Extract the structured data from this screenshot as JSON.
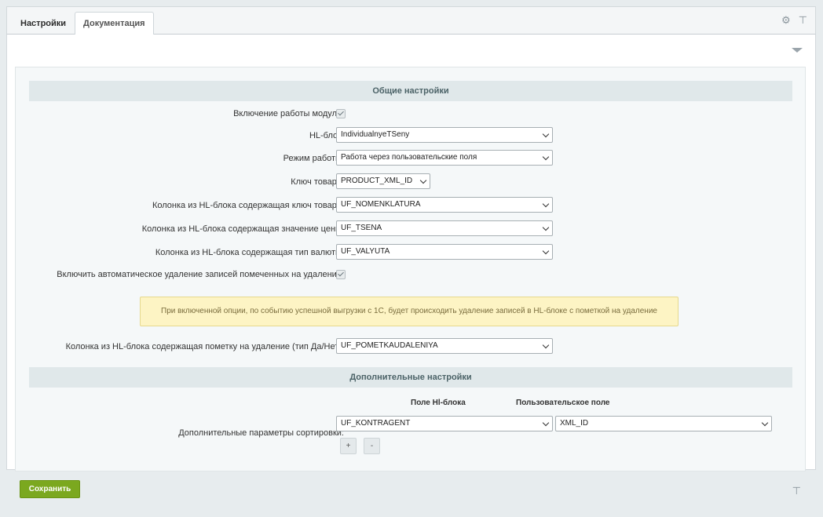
{
  "tabs": [
    {
      "label": "Настройки",
      "active": true
    },
    {
      "label": "Документация",
      "active": false
    }
  ],
  "header_icons": [
    "gear-icon",
    "pin-icon"
  ],
  "sections": {
    "general": "Общие настройки",
    "additional": "Дополнительные настройки"
  },
  "fields": {
    "enable_module": {
      "label": "Включение работы модуля:",
      "checked": true
    },
    "hl_block": {
      "label": "HL-блок:",
      "value": "IndividualnyeTSeny"
    },
    "mode": {
      "label": "Режим работы:",
      "value": "Работа через пользовательские поля"
    },
    "product_key": {
      "label": "Ключ товара:",
      "value": "PRODUCT_XML_ID"
    },
    "key_column": {
      "label": "Колонка из HL-блока содержащая ключ товара:",
      "value": "UF_NOMENKLATURA"
    },
    "price_column": {
      "label": "Колонка из HL-блока содержащая значение цены:",
      "value": "UF_TSENA"
    },
    "currency_column": {
      "label": "Колонка из HL-блока содержащая тип валюты:",
      "value": "UF_VALYUTA"
    },
    "auto_delete": {
      "label": "Включить автоматическое удаление записей помеченных на удаление:",
      "checked": true
    },
    "delete_mark_column": {
      "label": "Колонка из HL-блока содержащая пометку на удаление (тип Да/Нет):",
      "value": "UF_POMETKAUDALENIYA"
    }
  },
  "note": "При включенной опции, по событию успешной выгрузки с 1С, будет происходить удаление записей в HL-блоке с пометкой на удаление",
  "sorting": {
    "label": "Дополнительные параметры сортировки:",
    "col_hl": "Поле Hl-блока",
    "col_user": "Пользовательское поле",
    "hl_value": "UF_KONTRAGENT",
    "user_value": "XML_ID",
    "add_label": "+",
    "remove_label": "-"
  },
  "save_label": "Сохранить",
  "colors": {
    "save": "#7ba81f",
    "note_bg": "#fdf4c4",
    "section_bg": "#e0e8ea"
  }
}
